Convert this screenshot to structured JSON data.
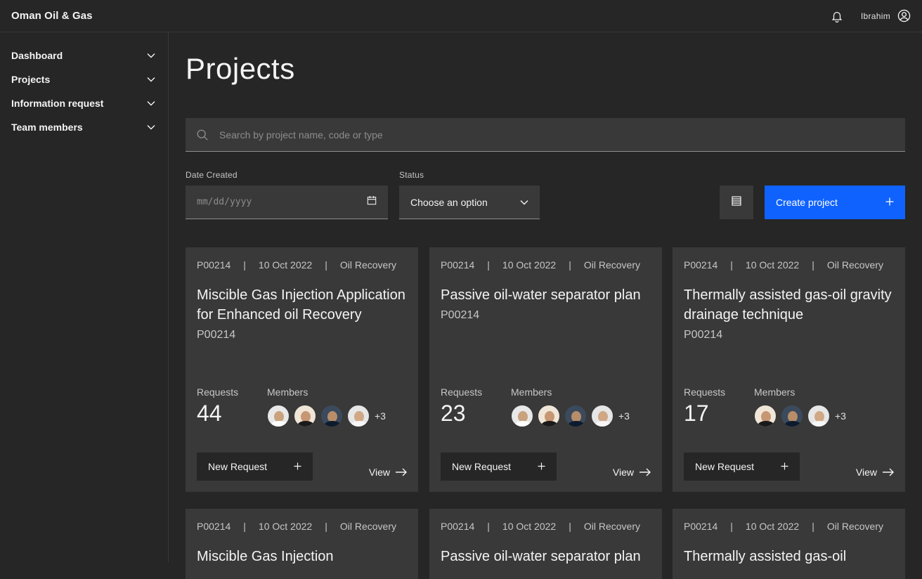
{
  "app": {
    "brand": "Oman Oil & Gas",
    "user_name": "Ibrahim"
  },
  "sidebar": {
    "items": [
      {
        "label": "Dashboard"
      },
      {
        "label": "Projects"
      },
      {
        "label": "Information request"
      },
      {
        "label": "Team members"
      }
    ]
  },
  "page": {
    "title": "Projects"
  },
  "search": {
    "placeholder": "Search by project name, code or type"
  },
  "filters": {
    "date_label": "Date Created",
    "date_placeholder": "mm/dd/yyyy",
    "status_label": "Status",
    "status_value": "Choose an option"
  },
  "actions": {
    "create_label": "Create project"
  },
  "colors": {
    "accent": "#0f62fe",
    "background": "#262626",
    "card": "#393939"
  },
  "cards": [
    {
      "code": "P00214",
      "date": "10 Oct 2022",
      "type": "Oil Recovery",
      "title": "Miscible Gas Injection Application for Enhanced oil Recovery",
      "sub_code": "P00214",
      "requests_label": "Requests",
      "requests": "44",
      "members_label": "Members",
      "more": "+3",
      "new_request": "New Request",
      "view": "View"
    },
    {
      "code": "P00214",
      "date": "10 Oct 2022",
      "type": "Oil Recovery",
      "title": "Passive oil-water separator plan",
      "sub_code": "P00214",
      "requests_label": "Requests",
      "requests": "23",
      "members_label": "Members",
      "more": "+3",
      "new_request": "New Request",
      "view": "View"
    },
    {
      "code": "P00214",
      "date": "10 Oct 2022",
      "type": "Oil Recovery",
      "title": "Thermally assisted gas-oil gravity drainage technique",
      "sub_code": "P00214",
      "requests_label": "Requests",
      "requests": "17",
      "members_label": "Members",
      "more": "+3",
      "new_request": "New Request",
      "view": "View"
    },
    {
      "code": "P00214",
      "date": "10 Oct 2022",
      "type": "Oil Recovery",
      "title": "Miscible Gas Injection"
    },
    {
      "code": "P00214",
      "date": "10 Oct 2022",
      "type": "Oil Recovery",
      "title": "Passive oil-water separator plan"
    },
    {
      "code": "P00214",
      "date": "10 Oct 2022",
      "type": "Oil Recovery",
      "title": "Thermally assisted gas-oil"
    }
  ]
}
